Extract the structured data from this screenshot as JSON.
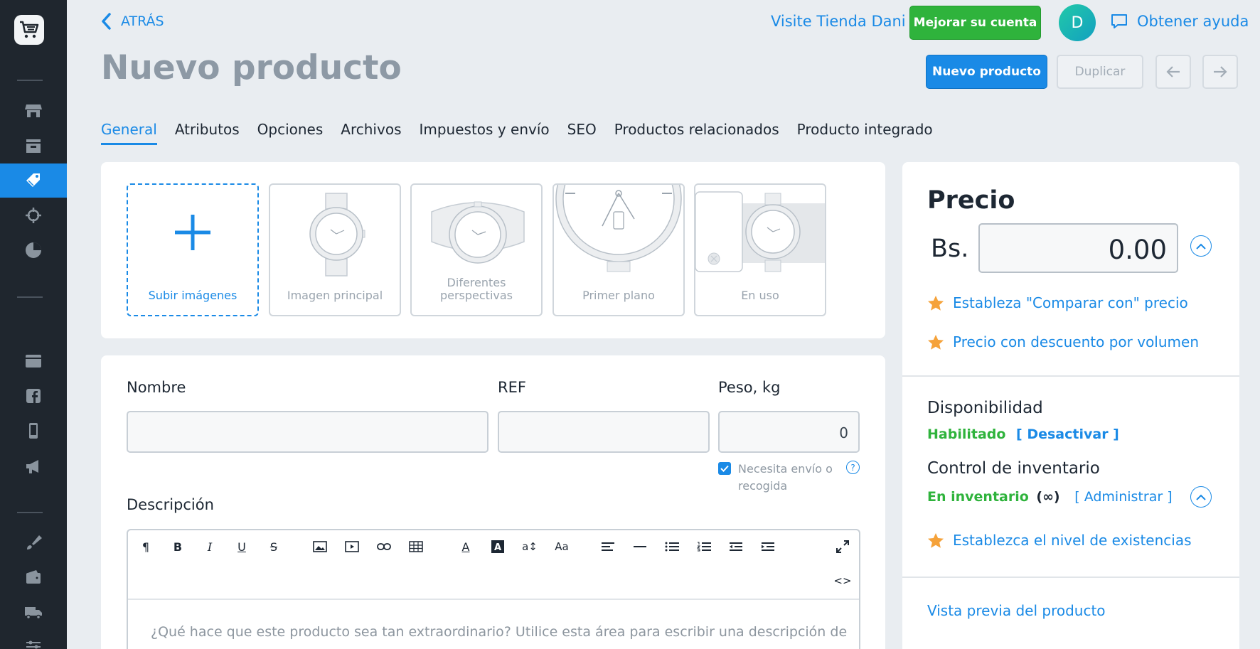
{
  "header": {
    "back_label": "ATRÁS",
    "title": "Nuevo producto",
    "visit_store": "Visite Tienda Dani",
    "upgrade": "Mejorar su cuenta",
    "avatar_initial": "D",
    "help": "Obtener ayuda",
    "new_product": "Nuevo producto",
    "duplicate": "Duplicar"
  },
  "tabs": [
    {
      "label": "General",
      "active": true
    },
    {
      "label": "Atributos"
    },
    {
      "label": "Opciones"
    },
    {
      "label": "Archivos"
    },
    {
      "label": "Impuestos y envío"
    },
    {
      "label": "SEO"
    },
    {
      "label": "Productos relacionados"
    },
    {
      "label": "Producto integrado"
    }
  ],
  "images": {
    "upload": "Subir imágenes",
    "main": "Imagen principal",
    "perspectives": "Diferentes perspectivas",
    "closeup": "Primer plano",
    "in_use": "En uso"
  },
  "form": {
    "name_label": "Nombre",
    "ref_label": "REF",
    "weight_label": "Peso, kg",
    "weight_value": "0",
    "shipping_checkbox": "Necesita envío o recogida",
    "description_label": "Descripción",
    "description_placeholder": "¿Qué hace que este producto sea tan extraordinario? Utilice esta área para escribir una descripción de"
  },
  "price": {
    "title": "Precio",
    "currency": "Bs.",
    "value": "0.00",
    "compare_link": "Estableza \"Comparar con\" precio",
    "bulk_link": "Precio con descuento por volumen"
  },
  "availability": {
    "title": "Disponibilidad",
    "status": "Habilitado",
    "action": "[ Desactivar ]"
  },
  "inventory": {
    "title": "Control de inventario",
    "status": "En inventario",
    "infinite": "(∞)",
    "action": "[ Administrar ]",
    "stock_link": "Establezca el nivel de existencias"
  },
  "preview_link": "Vista previa del producto",
  "colors": {
    "accent": "#1a8ae6",
    "success": "#2fb33c",
    "sidebar": "#1f262e",
    "star": "#f5a23a"
  }
}
